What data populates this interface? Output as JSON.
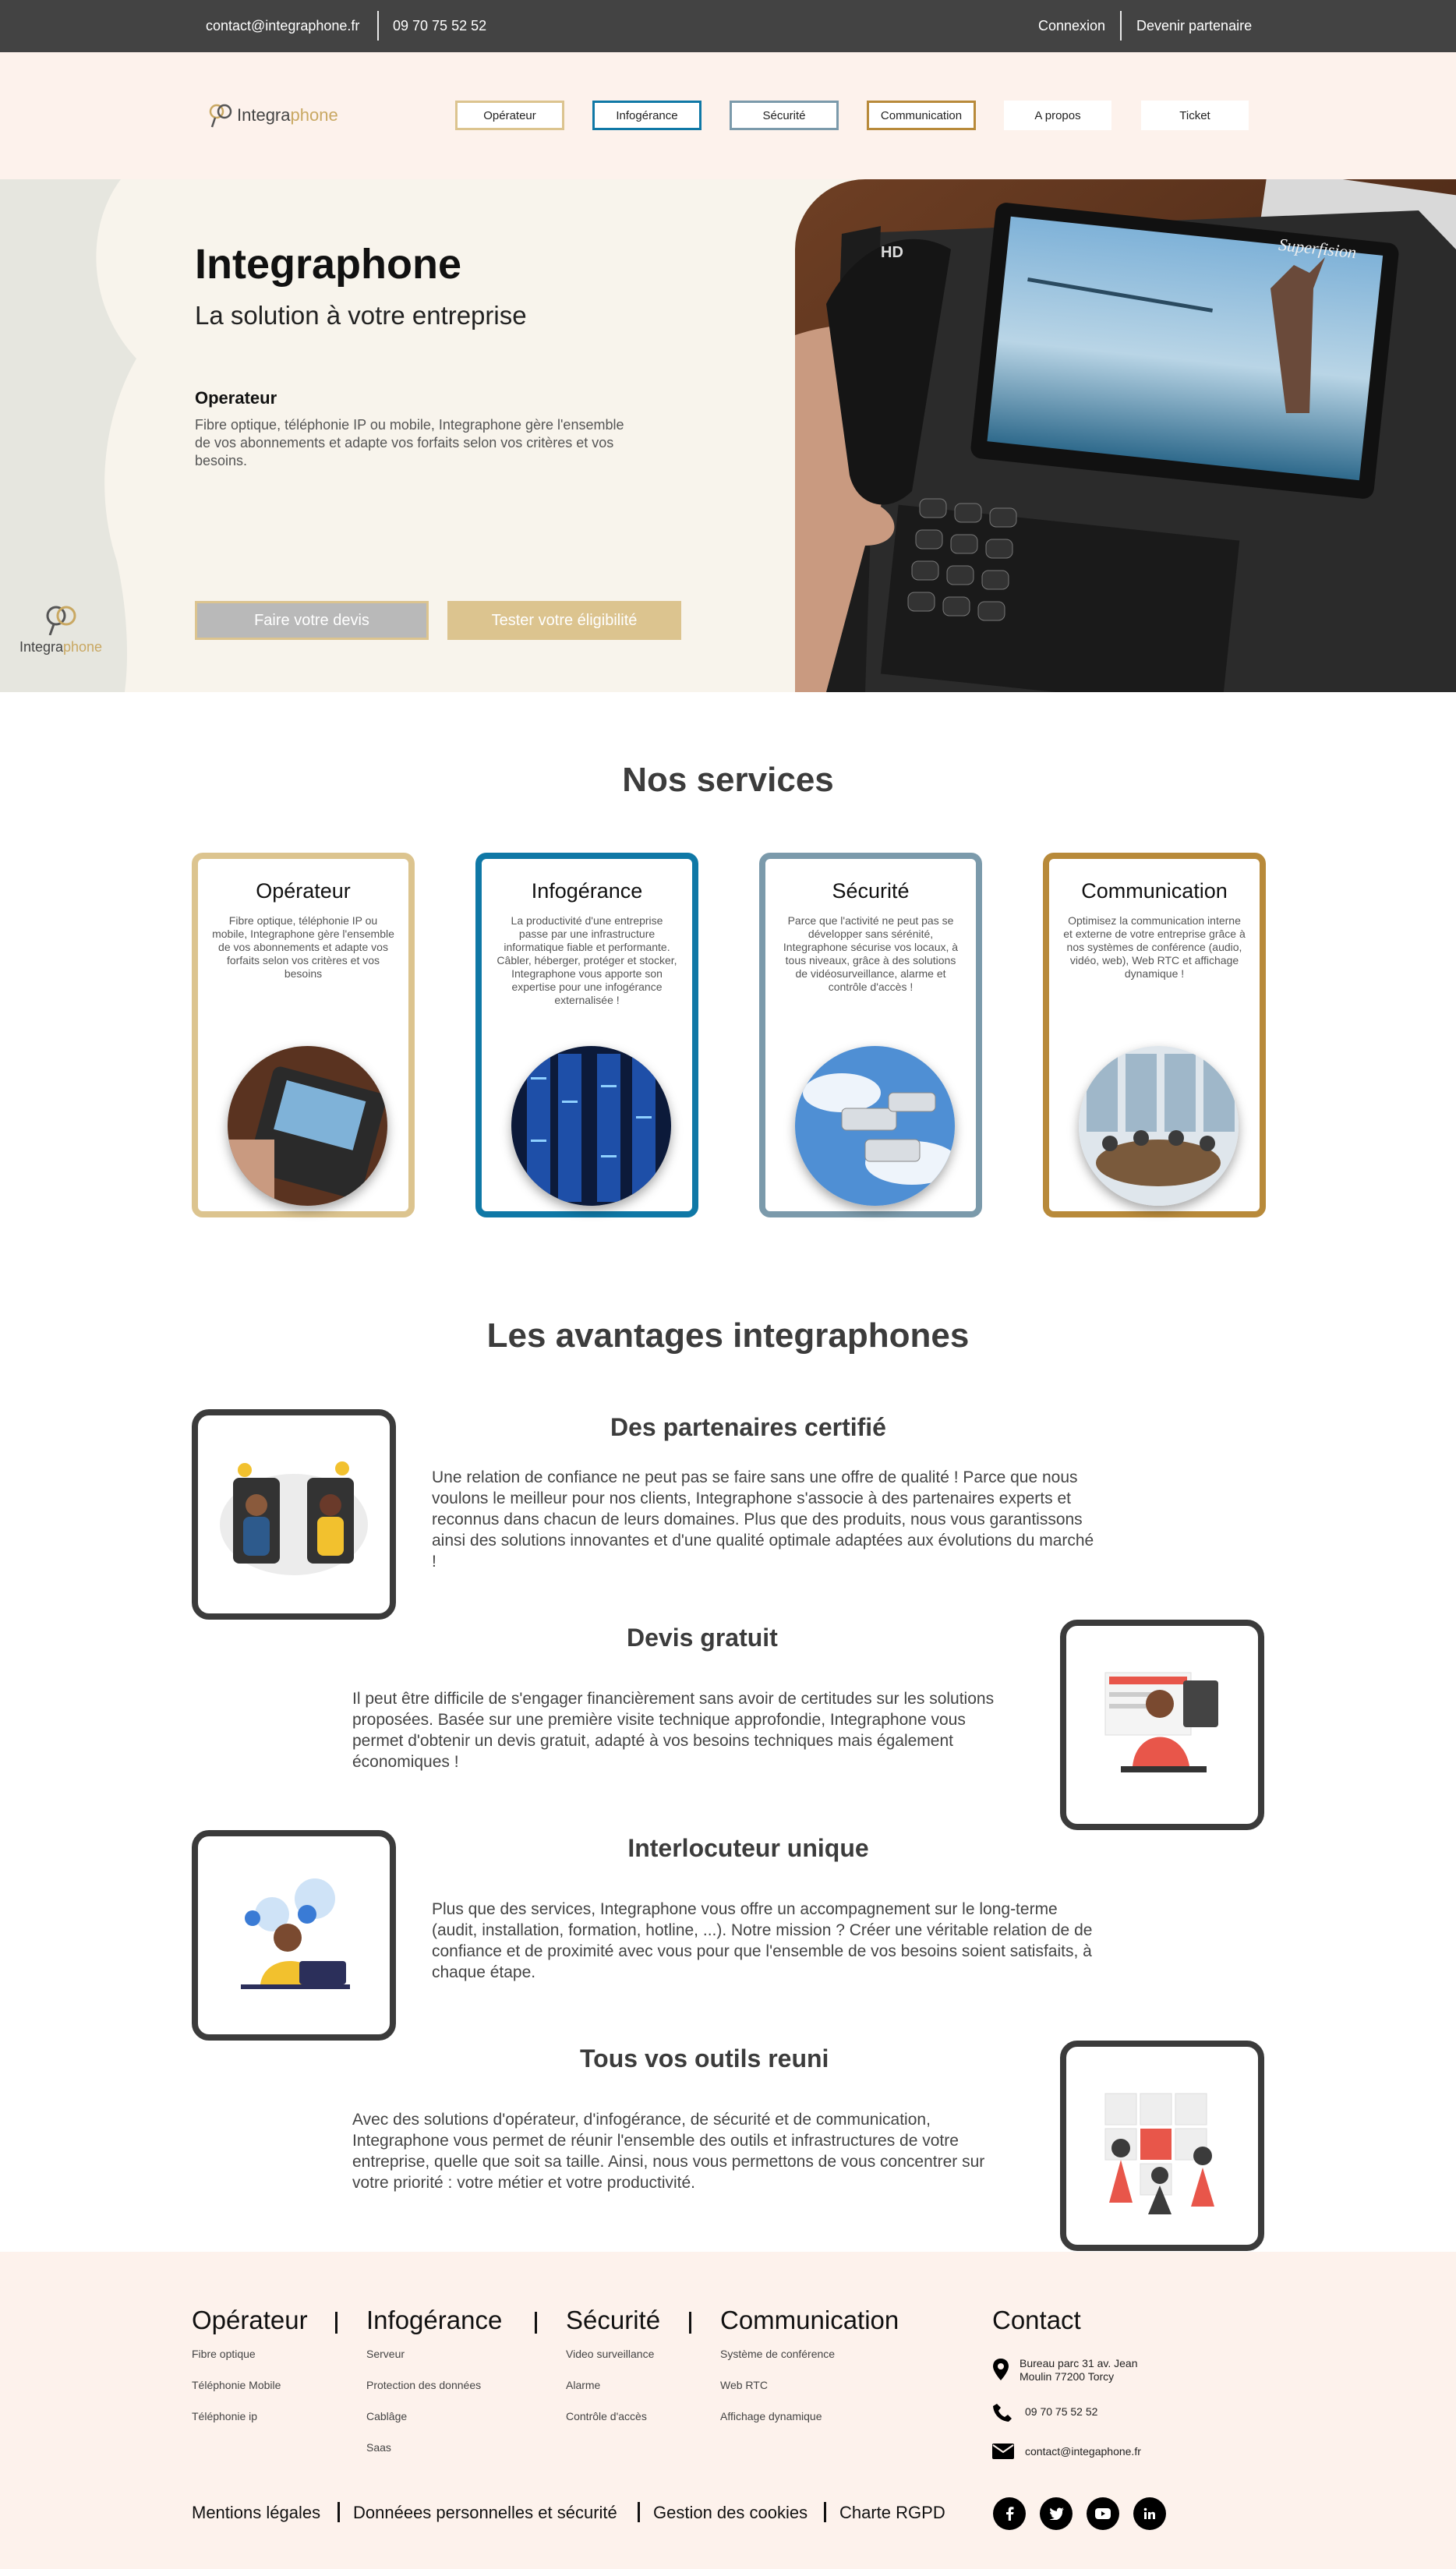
{
  "topbar": {
    "email": "contact@integraphone.fr",
    "phone": "09 70 75 52 52",
    "login": "Connexion",
    "partner": "Devenir partenaire"
  },
  "brand": {
    "logo_a": "Integra",
    "logo_b": "phone"
  },
  "nav": {
    "items": [
      "Opérateur",
      "Infogérance",
      "Sécurité",
      "Communication",
      "A propos",
      "Ticket"
    ]
  },
  "hero": {
    "title": "Integraphone",
    "subtitle": "La solution à votre entreprise",
    "section_title": "Operateur",
    "section_text": "Fibre optique, téléphonie IP ou mobile, Integraphone gère l'ensemble de vos abonnements et adapte vos forfaits selon vos critères et vos besoins.",
    "btn_quote": "Faire votre devis",
    "btn_eligibility": "Tester votre éligibilité",
    "screen_brand": "Superfision",
    "handset_label": "HD"
  },
  "services": {
    "title": "Nos services",
    "cards": [
      {
        "name": "Opérateur",
        "text": "Fibre optique, téléphonie IP ou mobile, Integraphone gère l'ensemble de vos abonnements et adapte vos forfaits selon vos critères et vos besoins"
      },
      {
        "name": "Infogérance",
        "text": "La productivité d'une entreprise passe par une infrastructure informatique fiable et performante. Câbler, héberger, protéger et stocker, Integraphone vous apporte son expertise pour une infogérance externalisée !"
      },
      {
        "name": "Sécurité",
        "text": "Parce que l'activité ne peut pas se développer sans sérénité, Integraphone sécurise vos locaux, à tous niveaux, grâce à des solutions de vidéosurveillance, alarme et contrôle d'accès !"
      },
      {
        "name": "Communication",
        "text": "Optimisez la communication interne et externe de votre entreprise grâce à nos systèmes de conférence (audio, vidéo, web), Web RTC et affichage dynamique !"
      }
    ]
  },
  "advantages": {
    "title": "Les avantages integraphones",
    "items": [
      {
        "title": "Des partenaires certifié",
        "text": "Une relation de confiance ne peut pas se faire sans une offre de qualité ! Parce que nous voulons le meilleur pour nos clients, Integraphone s'associe à des partenaires experts et reconnus dans chacun de leurs domaines. Plus que des produits, nous vous garantissons ainsi des solutions innovantes et d'une qualité optimale adaptées aux évolutions du marché !"
      },
      {
        "title": "Devis gratuit",
        "text": "Il peut être difficile de s'engager financièrement sans avoir de certitudes sur les solutions proposées. Basée sur une première visite technique approfondie, Integraphone vous permet d'obtenir un devis gratuit, adapté à vos besoins techniques mais également économiques !"
      },
      {
        "title": "Interlocuteur unique",
        "text": "Plus que des services, Integraphone vous offre un accompagnement sur le long-terme (audit, installation, formation, hotline, ...). Notre mission ? Créer une véritable relation de de confiance et de proximité avec vous pour que l'ensemble de vos besoins soient satisfaits, à chaque étape."
      },
      {
        "title": "Tous vos outils reuni",
        "text": "Avec des solutions d'opérateur, d'infogérance, de sécurité et de communication, Integraphone vous permet de réunir l'ensemble des outils et infrastructures de votre entreprise, quelle que soit sa taille. Ainsi, nous vous permettons de vous concentrer sur votre priorité : votre métier et votre productivité."
      }
    ]
  },
  "footer": {
    "cols": [
      {
        "title": "Opérateur",
        "links": [
          "Fibre optique",
          "Téléphonie Mobile",
          "Téléphonie ip"
        ]
      },
      {
        "title": "Infogérance",
        "links": [
          "Serveur",
          "Protection des données",
          "Cablâge",
          "Saas"
        ]
      },
      {
        "title": "Sécurité",
        "links": [
          "Video surveillance",
          "Alarme",
          "Contrôle d'accès"
        ]
      },
      {
        "title": "Communication",
        "links": [
          "Système de conférence",
          "Web RTC",
          "Affichage dynamique"
        ]
      }
    ],
    "contact": {
      "title": "Contact",
      "address1": "Bureau parc 31 av. Jean",
      "address2": "Moulin 77200 Torcy",
      "phone": "09 70 75 52 52",
      "email": "contact@integaphone.fr"
    },
    "bottom_links": [
      "Mentions légales",
      "Donnéees personnelles et sécurité",
      "Gestion des cookies",
      "Charte RGPD"
    ],
    "social": [
      "facebook-icon",
      "twitter-icon",
      "youtube-icon",
      "linkedin-icon"
    ]
  },
  "colors": {
    "topbar": "#434343",
    "nav_bg": "#fdf2ec",
    "hero_bg": "#f8f4ec",
    "gold": "#dcc48f",
    "blue": "#0f78a6",
    "steel": "#7b9aab",
    "amber": "#b88a3a",
    "dark": "#3b3b3b"
  }
}
